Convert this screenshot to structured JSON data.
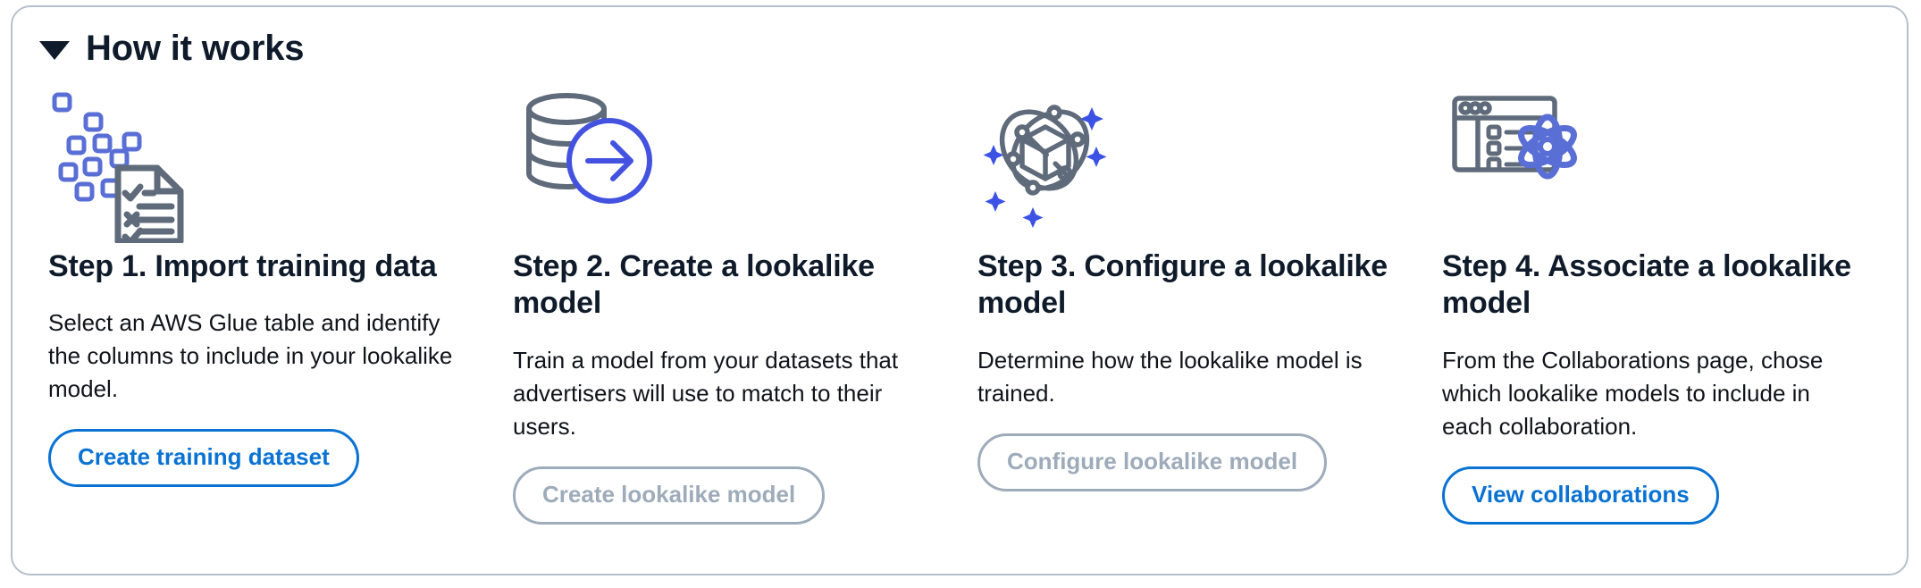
{
  "panel": {
    "title": "How it works",
    "collapse_icon": "caret-down-icon",
    "expanded": true,
    "border_color": "#b6c0cd"
  },
  "colors": {
    "link_blue": "#0972d3",
    "disabled_gray": "#9eabba",
    "icon_gray": "#5f6b7a",
    "icon_blue": "#5a6fd6",
    "accent_blue": "#4353e0",
    "heading": "#0f1b2a"
  },
  "steps": [
    {
      "icon": "document-checklist-data-icon",
      "title": "Step 1. Import training data",
      "description": "Select an AWS Glue table and identify the columns to include in your lookalike model.",
      "button": {
        "label": "Create training dataset",
        "state": "enabled"
      }
    },
    {
      "icon": "database-arrow-icon",
      "title": "Step 2. Create a lookalike model",
      "description": "Train a model from your datasets that advertisers will use to match to their users.",
      "button": {
        "label": "Create lookalike model",
        "state": "disabled"
      }
    },
    {
      "icon": "atom-cube-sparkle-icon",
      "title": "Step 3. Configure a lookalike model",
      "description": "Determine how the lookalike model is trained.",
      "button": {
        "label": "Configure lookalike model",
        "state": "disabled"
      }
    },
    {
      "icon": "browser-list-atom-icon",
      "title": "Step 4. Associate a lookalike model",
      "description": "From the Collaborations page, chose which lookalike models to include in each collaboration.",
      "button": {
        "label": "View collaborations",
        "state": "enabled"
      }
    }
  ]
}
